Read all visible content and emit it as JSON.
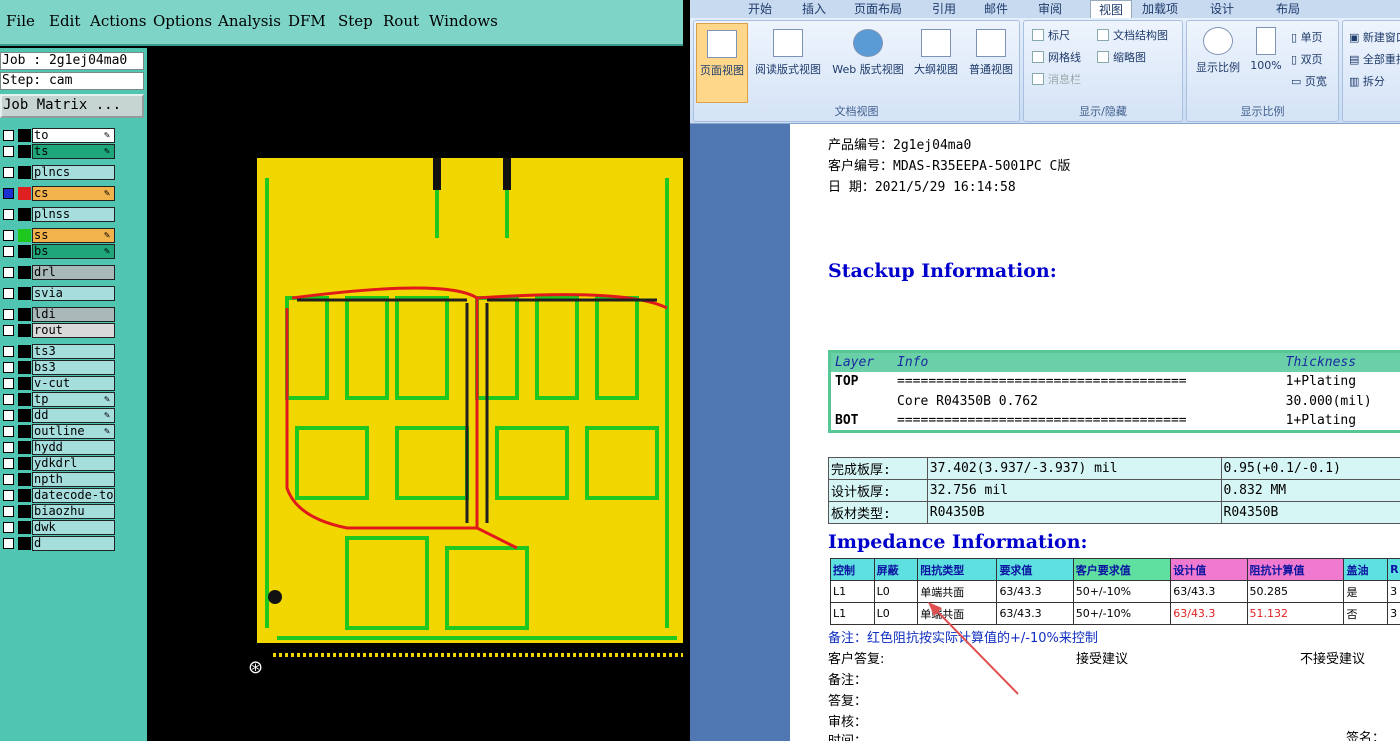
{
  "cam": {
    "menu": [
      "File",
      "Edit",
      "Actions",
      "Options",
      "Analysis",
      "DFM",
      "Step",
      "Rout",
      "Windows"
    ],
    "job": "Job : 2g1ej04ma0",
    "step": "Step: cam",
    "job_matrix": "Job Matrix ...",
    "layers": [
      "to",
      "ts",
      "plncs",
      "cs",
      "plnss",
      "ss",
      "bs",
      "drl",
      "svia",
      "ldi",
      "rout",
      "ts3",
      "bs3",
      "v-cut",
      "tp",
      "dd",
      "outline",
      "hydd",
      "ydkdrl",
      "npth",
      "datecode-to",
      "biaozhu",
      "dwk",
      "d"
    ]
  },
  "word": {
    "tabs": [
      "开始",
      "插入",
      "页面布局",
      "引用",
      "邮件",
      "审阅",
      "视图",
      "加载项",
      "设计",
      "布局"
    ],
    "views": [
      "页面视图",
      "阅读版式视图",
      "Web 版式视图",
      "大纲视图",
      "普通视图"
    ],
    "group_doc_views": "文档视图",
    "show_items": [
      "标尺",
      "网格线",
      "消息栏",
      "文档结构图",
      "缩略图"
    ],
    "group_show": "显示/隐藏",
    "zoom_btns": [
      "显示比例",
      "100%"
    ],
    "zoom_small": [
      "单页",
      "双页",
      "页宽"
    ],
    "group_zoom": "显示比例",
    "window_btns": [
      "新建窗口",
      "全部重排",
      "拆分"
    ]
  },
  "doc": {
    "product_no": "产品编号：2g1ej04ma0",
    "customer_no": "客户编号：MDAS-R35EEPA-5001PC C版",
    "date": "日    期：2021/5/29 16:14:58",
    "stackup_title": "Stackup Information:",
    "stackup_header": [
      "Layer",
      "Info",
      "Thickness"
    ],
    "stackup_rows": [
      [
        "TOP",
        "=====================================",
        "1+Plating"
      ],
      [
        "",
        "Core      R04350B    0.762",
        "30.000(mil)"
      ],
      [
        "BOT",
        "=====================================",
        "1+Plating"
      ]
    ],
    "thickness_rows": [
      [
        "完成板厚:",
        "37.402(3.937/-3.937) mil",
        "0.95(+0.1/-0.1)"
      ],
      [
        "设计板厚:",
        "32.756 mil",
        "0.832 MM"
      ],
      [
        "板材类型:",
        "R04350B",
        "R04350B"
      ]
    ],
    "impedance_title": "Impedance Information:",
    "imp_header": [
      "控制",
      "屏蔽",
      "阻抗类型",
      "要求值",
      "客户要求值",
      "设计值",
      "阻抗计算值",
      "盖油",
      "R"
    ],
    "imp_rows": [
      [
        "L1",
        "L0",
        "单端共面",
        "63/43.3",
        "50+/-10%",
        "63/43.3",
        "50.285",
        "是",
        "3"
      ],
      [
        "L1",
        "L0",
        "单端共面",
        "63/43.3",
        "50+/-10%",
        "63/43.3",
        "51.132",
        "否",
        "3"
      ]
    ],
    "note": "备注：红色阻抗按实际计算值的+/-10%来控制",
    "reply_label": "客户答复:",
    "accept": "接受建议",
    "reject": "不接受建议",
    "memo": "备注：",
    "answer": "答复：",
    "review": "审核：",
    "time": "时间：",
    "sign": "签名："
  }
}
